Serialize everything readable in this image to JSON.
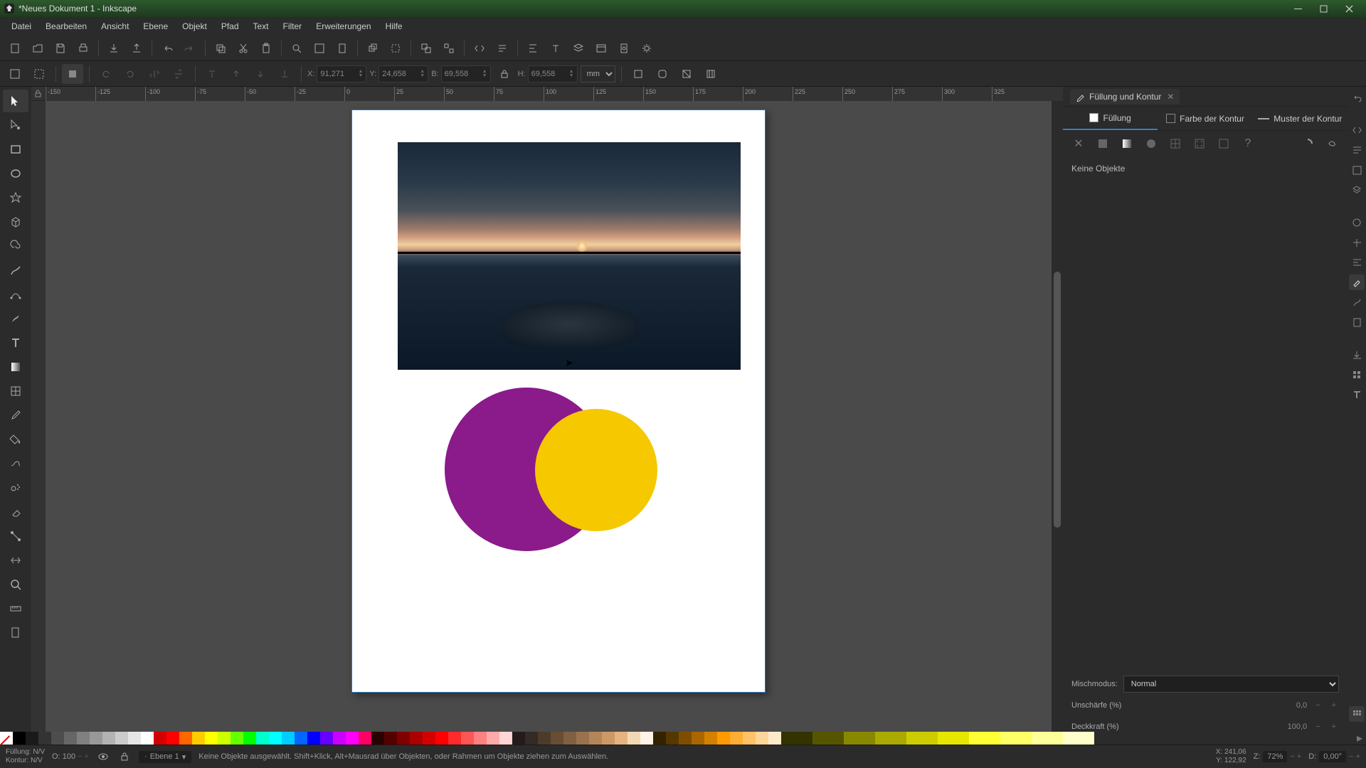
{
  "window": {
    "title": "*Neues Dokument 1 - Inkscape"
  },
  "menu": [
    "Datei",
    "Bearbeiten",
    "Ansicht",
    "Ebene",
    "Objekt",
    "Pfad",
    "Text",
    "Filter",
    "Erweiterungen",
    "Hilfe"
  ],
  "tooloptions": {
    "x_label": "X:",
    "x": "91,271",
    "y_label": "Y:",
    "y": "24,658",
    "w_label": "B:",
    "w": "69,558",
    "h_label": "H:",
    "h": "69,558",
    "unit": "mm"
  },
  "ruler_h": [
    "-150",
    "-125",
    "-100",
    "-75",
    "-50",
    "-25",
    "0",
    "25",
    "50",
    "75",
    "100",
    "125",
    "150",
    "175",
    "200",
    "225",
    "250",
    "275",
    "300",
    "325"
  ],
  "panel": {
    "tab_title": "Füllung und Kontur",
    "tab_fill": "Füllung",
    "tab_stroke_paint": "Farbe der Kontur",
    "tab_stroke_style": "Muster der Kontur",
    "empty": "Keine Objekte",
    "blend_label": "Mischmodus:",
    "blend_value": "Normal",
    "blur_label": "Unschärfe (%)",
    "blur_value": "0,0",
    "opacity_label": "Deckkraft (%)",
    "opacity_value": "100,0"
  },
  "status": {
    "fill_label": "Füllung:",
    "stroke_label": "Kontur:",
    "nv": "N/V",
    "o_label": "O:",
    "o_value": "100",
    "layer": "Ebene 1",
    "hint": "Keine Objekte ausgewählt. Shift+Klick, Alt+Mausrad über Objekten, oder Rahmen um Objekte ziehen zum Auswählen.",
    "x_label": "X:",
    "x": "241,06",
    "y_label": "Y:",
    "y": "122,92",
    "z_label": "Z:",
    "z": "72%",
    "d_label": "D:",
    "d": "0,00°"
  },
  "palette_basic": [
    "#000000",
    "#1a1a1a",
    "#333333",
    "#4d4d4d",
    "#666666",
    "#808080",
    "#999999",
    "#b3b3b3",
    "#cccccc",
    "#e6e6e6",
    "#ffffff",
    "#d40000",
    "#ff0000",
    "#ff6600",
    "#ffcc00",
    "#ffff00",
    "#ccff00",
    "#66ff00",
    "#00ff00",
    "#00ffcc",
    "#00ffff",
    "#00ccff",
    "#0066ff",
    "#0000ff",
    "#6600ff",
    "#cc00ff",
    "#ff00ff",
    "#ff0066"
  ],
  "palette_reds": [
    "#2b0000",
    "#550000",
    "#800000",
    "#aa0000",
    "#d40000",
    "#ff0000",
    "#ff2a2a",
    "#ff5555",
    "#ff8080",
    "#ffaaaa",
    "#ffd5d5"
  ],
  "palette_browns": [
    "#241c1c",
    "#332b24",
    "#4d3b2a",
    "#664d33",
    "#806040",
    "#99734d",
    "#b38659",
    "#cc9966",
    "#e6b380",
    "#f2d9b3",
    "#fff2e6"
  ],
  "palette_oranges": [
    "#332200",
    "#553800",
    "#804d00",
    "#aa6600",
    "#d48000",
    "#ff9900",
    "#ffad33",
    "#ffc266",
    "#ffd699",
    "#ffebcc"
  ],
  "palette_yellows": [
    "#333300",
    "#555500",
    "#888800",
    "#aaaa00",
    "#cccc00",
    "#e6e600",
    "#ffff33",
    "#ffff66",
    "#ffff99",
    "#ffffcc"
  ]
}
